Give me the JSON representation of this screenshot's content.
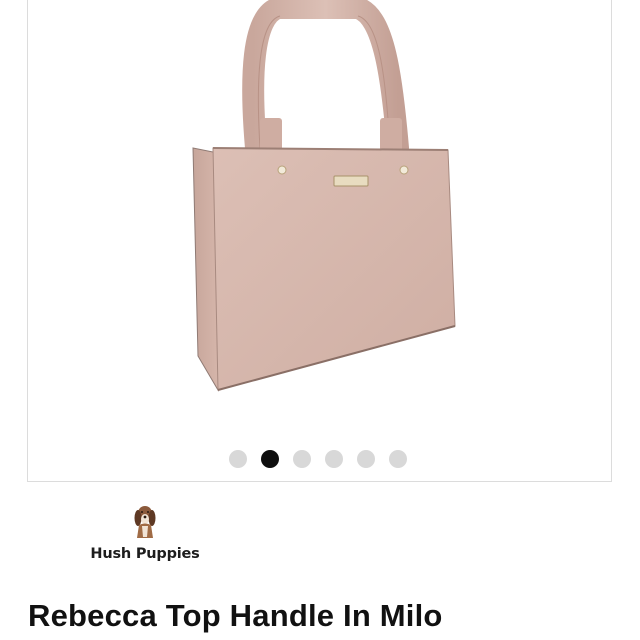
{
  "gallery": {
    "image_alt": "Rebecca Top Handle In Milo",
    "dots": [
      {
        "active": false
      },
      {
        "active": true
      },
      {
        "active": false
      },
      {
        "active": false
      },
      {
        "active": false
      },
      {
        "active": false
      }
    ]
  },
  "brand": {
    "name": "Hush Puppies",
    "logo_icon": "basset-hound-icon"
  },
  "product": {
    "title": "Rebecca Top Handle In Milo"
  },
  "colors": {
    "bag": "#d6b6ab",
    "dot_inactive": "#d8d8d8",
    "dot_active": "#0e0e0e",
    "title": "#111111"
  }
}
